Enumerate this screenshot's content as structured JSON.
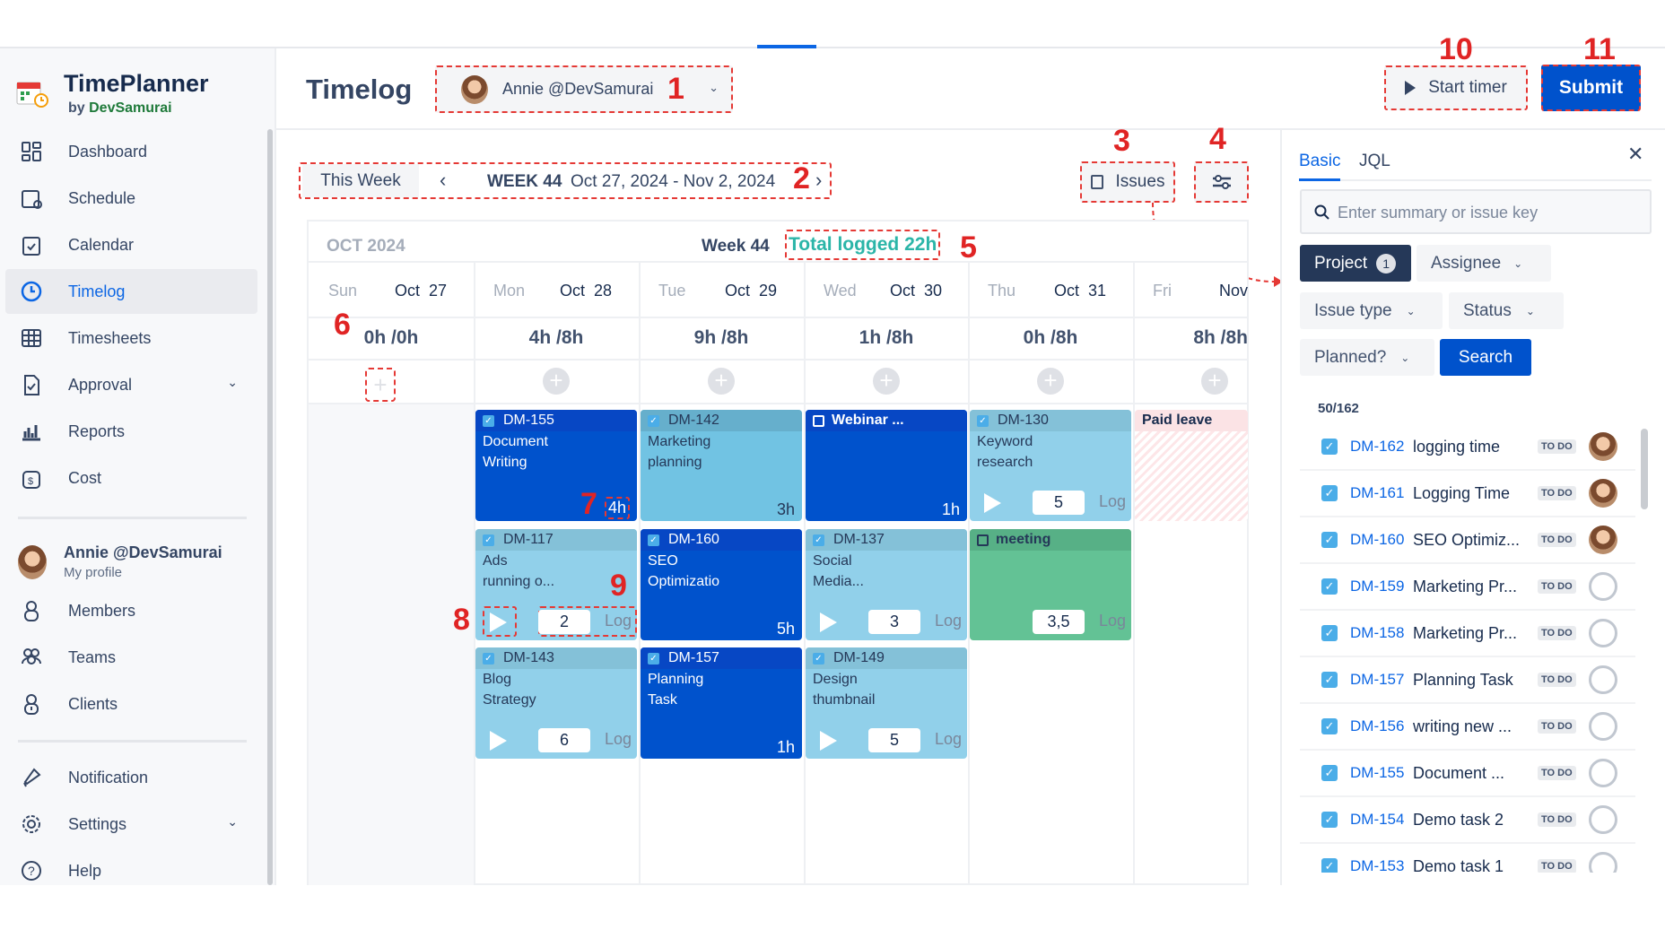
{
  "app": {
    "name": "TimePlanner",
    "by": "by",
    "vendor": "DevSamurai"
  },
  "sidebar": {
    "items": [
      {
        "label": "Dashboard",
        "icon": "dashboard-icon"
      },
      {
        "label": "Schedule",
        "icon": "schedule-icon"
      },
      {
        "label": "Calendar",
        "icon": "calendar-icon"
      },
      {
        "label": "Timelog",
        "icon": "clock-icon",
        "active": true
      },
      {
        "label": "Timesheets",
        "icon": "table-icon"
      },
      {
        "label": "Approval",
        "icon": "approval-icon",
        "expandable": true
      },
      {
        "label": "Reports",
        "icon": "bar-chart-icon"
      },
      {
        "label": "Cost",
        "icon": "cost-icon"
      }
    ],
    "profile": {
      "name": "Annie @DevSamurai",
      "sub": "My profile"
    },
    "items2": [
      {
        "label": "Members",
        "icon": "user-icon"
      },
      {
        "label": "Teams",
        "icon": "team-icon"
      },
      {
        "label": "Clients",
        "icon": "client-icon"
      }
    ],
    "items3": [
      {
        "label": "Notification",
        "icon": "bell-icon"
      },
      {
        "label": "Settings",
        "icon": "gear-icon",
        "expandable": true
      },
      {
        "label": "Help",
        "icon": "help-icon"
      }
    ]
  },
  "header": {
    "title": "Timelog",
    "user": "Annie @DevSamurai",
    "start_timer": "Start timer",
    "submit": "Submit"
  },
  "week_nav": {
    "this_week": "This Week",
    "week": "WEEK 44",
    "range": "Oct 27, 2024 - Nov 2, 2024"
  },
  "toolbar": {
    "issues": "Issues"
  },
  "calendar": {
    "month": "OCT 2024",
    "week": "Week 44",
    "total": "Total logged 22h",
    "days": [
      {
        "dow": "Sun",
        "date": "Oct  27",
        "hours": "0h /0h",
        "cards": []
      },
      {
        "dow": "Mon",
        "date": "Oct  28",
        "hours": "4h /8h",
        "cards": [
          {
            "kind": "issue",
            "style": "dark",
            "key": "DM-155",
            "lines": [
              "Document",
              "Writing"
            ],
            "hours": "4h"
          },
          {
            "kind": "issue",
            "style": "light",
            "key": "DM-117",
            "lines": [
              "Ads",
              "running o..."
            ],
            "input": "2",
            "log": "Log"
          },
          {
            "kind": "issue",
            "style": "light",
            "key": "DM-143",
            "lines": [
              "Blog",
              "Strategy"
            ],
            "input": "6",
            "log": "Log"
          }
        ]
      },
      {
        "dow": "Tue",
        "date": "Oct  29",
        "hours": "9h /8h",
        "cards": [
          {
            "kind": "issue",
            "style": "mid",
            "key": "DM-142",
            "lines": [
              "Marketing",
              "planning"
            ],
            "hours": "3h"
          },
          {
            "kind": "issue",
            "style": "dark",
            "key": "DM-160",
            "lines": [
              "SEO",
              "Optimizatio"
            ],
            "hours": "5h"
          },
          {
            "kind": "issue",
            "style": "dark",
            "key": "DM-157",
            "lines": [
              "Planning",
              "Task"
            ],
            "hours": "1h"
          }
        ]
      },
      {
        "dow": "Wed",
        "date": "Oct  30",
        "hours": "1h /8h",
        "cards": [
          {
            "kind": "event",
            "style": "dark",
            "key": "Webinar ...",
            "lines": [],
            "hours": "1h"
          },
          {
            "kind": "issue",
            "style": "light",
            "key": "DM-137",
            "lines": [
              "Social",
              "Media..."
            ],
            "input": "3",
            "log": "Log"
          },
          {
            "kind": "issue",
            "style": "light",
            "key": "DM-149",
            "lines": [
              "Design",
              "thumbnail"
            ],
            "input": "5",
            "log": "Log"
          }
        ]
      },
      {
        "dow": "Thu",
        "date": "Oct  31",
        "hours": "0h /8h",
        "cards": [
          {
            "kind": "issue",
            "style": "light",
            "key": "DM-130",
            "lines": [
              "Keyword",
              "research"
            ],
            "input": "5",
            "log": "Log"
          },
          {
            "kind": "event",
            "style": "green",
            "key": "meeting",
            "lines": [],
            "input": "3,5",
            "log": "Log"
          }
        ]
      },
      {
        "dow": "Fri",
        "date": "Nov",
        "hours": "8h /8h",
        "cards": [
          {
            "kind": "leave",
            "style": "leave",
            "key": "Paid leave",
            "lines": []
          }
        ]
      }
    ]
  },
  "panel": {
    "tabs": [
      "Basic",
      "JQL"
    ],
    "active_tab": "Basic",
    "search_placeholder": "Enter summary or issue key",
    "filters": {
      "project": "Project",
      "project_count": "1",
      "assignee": "Assignee",
      "issue_type": "Issue type",
      "status": "Status",
      "planned": "Planned?",
      "search": "Search"
    },
    "count": "50/162",
    "issues": [
      {
        "key": "DM-162",
        "title": "logging time",
        "status": "TO DO",
        "avatar": "user"
      },
      {
        "key": "DM-161",
        "title": "Logging Time",
        "status": "TO DO",
        "avatar": "user"
      },
      {
        "key": "DM-160",
        "title": "SEO Optimiz...",
        "status": "TO DO",
        "avatar": "user"
      },
      {
        "key": "DM-159",
        "title": "Marketing Pr...",
        "status": "TO DO",
        "avatar": "none"
      },
      {
        "key": "DM-158",
        "title": "Marketing Pr...",
        "status": "TO DO",
        "avatar": "none"
      },
      {
        "key": "DM-157",
        "title": "Planning Task",
        "status": "TO DO",
        "avatar": "none"
      },
      {
        "key": "DM-156",
        "title": "writing new ...",
        "status": "TO DO",
        "avatar": "none"
      },
      {
        "key": "DM-155",
        "title": "Document ...",
        "status": "TO DO",
        "avatar": "none"
      },
      {
        "key": "DM-154",
        "title": "Demo task 2",
        "status": "TO DO",
        "avatar": "none"
      },
      {
        "key": "DM-153",
        "title": "Demo task 1",
        "status": "TO DO",
        "avatar": "none"
      }
    ]
  },
  "annotations": [
    "1",
    "2",
    "3",
    "4",
    "5",
    "6",
    "7",
    "8",
    "9",
    "10",
    "11"
  ],
  "colors": {
    "primary": "#0052cc",
    "light_card": "#91d0ea",
    "event_green": "#63c295",
    "total_teal": "#2bb5a8",
    "annotation_red": "#e02424"
  }
}
